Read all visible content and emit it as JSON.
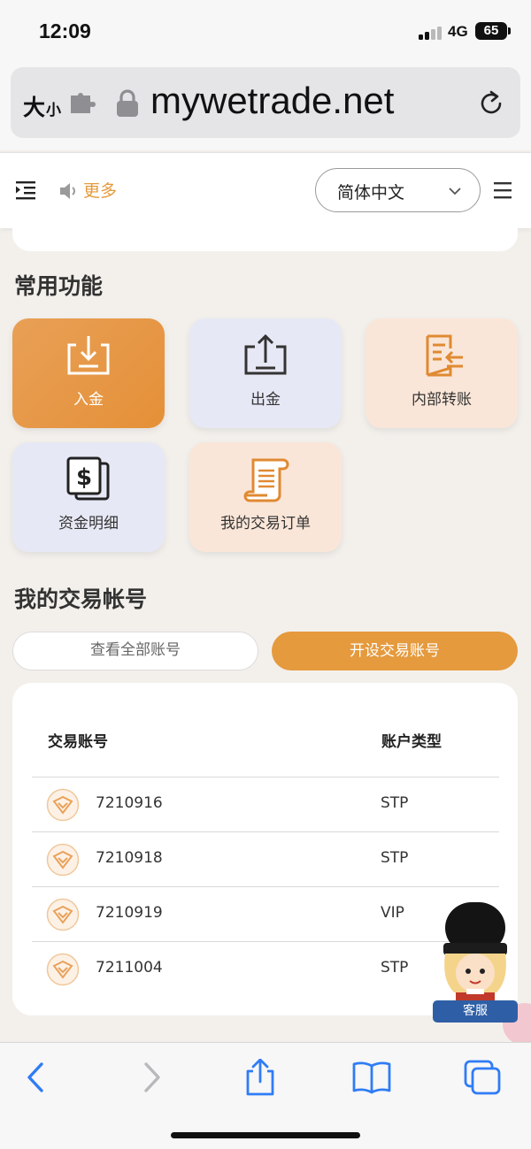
{
  "status_bar": {
    "time": "12:09",
    "network": "4G",
    "battery": "65"
  },
  "browser": {
    "text_size_big": "大",
    "text_size_small": "小",
    "url": "mywetrade.net"
  },
  "header": {
    "more_label": "更多",
    "language": "简体中文"
  },
  "common_functions": {
    "title": "常用功能",
    "items": [
      {
        "label": "入金",
        "icon": "deposit-icon"
      },
      {
        "label": "出金",
        "icon": "withdraw-icon"
      },
      {
        "label": "内部转账",
        "icon": "transfer-icon"
      },
      {
        "label": "资金明细",
        "icon": "dollar-doc-icon"
      },
      {
        "label": "我的交易订单",
        "icon": "scroll-icon"
      }
    ]
  },
  "accounts": {
    "title": "我的交易帐号",
    "view_all_label": "查看全部账号",
    "open_label": "开设交易账号",
    "col_account": "交易账号",
    "col_type": "账户类型",
    "rows": [
      {
        "number": "7210916",
        "type": "STP"
      },
      {
        "number": "7210918",
        "type": "STP"
      },
      {
        "number": "7210919",
        "type": "VIP"
      },
      {
        "number": "7211004",
        "type": "STP"
      }
    ]
  },
  "customer_service": {
    "label": "客服"
  },
  "colors": {
    "accent": "#e59a3d",
    "tile_blue": "#e7e8f5",
    "tile_peach": "#fae6d8",
    "page_bg": "#f3f0ec"
  }
}
